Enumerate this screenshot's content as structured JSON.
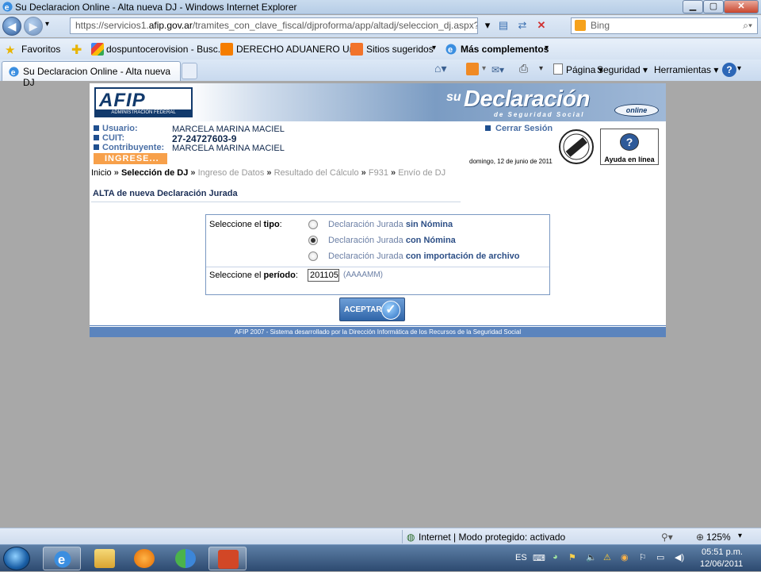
{
  "window": {
    "title": "Su Declaracion Online - Alta nueva DJ - Windows Internet Explorer",
    "min_icon": "minimize-icon",
    "max_icon": "maximize-icon",
    "close_icon": "close-icon"
  },
  "address": {
    "prefix": "https://servicios1.",
    "domain": "afip.gov.ar",
    "path": "/tramites_con_clave_fiscal/djproforma/app/altadj/seleccion_dj.aspx?",
    "search_placeholder": "Bing"
  },
  "favorites": {
    "label": "Favoritos",
    "items": [
      "dospuntocerovision - Busc...",
      "DERECHO ADUANERO Un...",
      "Sitios sugeridos",
      "Más complementos"
    ]
  },
  "tab": {
    "label": "Su Declaracion Online - Alta nueva DJ"
  },
  "tools": {
    "pagina": "Página",
    "seguridad": "Seguridad",
    "herramientas": "Herramientas"
  },
  "page": {
    "logo": {
      "big": "AFIP",
      "small": "ADMINISTRACION FEDERAL"
    },
    "brand": {
      "su": "su",
      "title": "Declaración",
      "subtitle": "de Seguridad Social",
      "online": "online"
    },
    "user": {
      "usuario_label": "Usuario:",
      "usuario": "MARCELA MARINA MACIEL",
      "cuit_label": "CUIT:",
      "cuit": "27-24727603-9",
      "contribuyente_label": "Contribuyente:",
      "contribuyente": "MARCELA MARINA MACIEL",
      "ingrese": "INGRESE..."
    },
    "cerrar_sesion": "Cerrar Sesión",
    "date": "domingo, 12 de junio de 2011",
    "ayuda": "Ayuda en línea",
    "breadcrumb": {
      "sep": "»",
      "items": [
        "Inicio",
        "Selección de DJ",
        "Ingreso de Datos",
        "Resultado del Cálculo",
        "F931",
        "Envío de DJ"
      ]
    },
    "title": "ALTA de nueva Declaración Jurada",
    "form": {
      "tipo_label_pre": "Seleccione el ",
      "tipo_label_b": "tipo",
      "tipo_label_post": ":",
      "options": [
        {
          "pre": "Declaración Jurada ",
          "b": "sin Nómina",
          "selected": false
        },
        {
          "pre": "Declaración Jurada ",
          "b": "con Nómina",
          "selected": true
        },
        {
          "pre": "Declaración Jurada ",
          "b": "con importación de archivo",
          "selected": false
        }
      ],
      "periodo_label_pre": "Seleccione el ",
      "periodo_label_b": "período",
      "periodo_label_post": ":",
      "periodo_value": "201105",
      "periodo_format": "(AAAAMM)"
    },
    "button": "ACEPTAR",
    "footer": "AFIP 2007 - Sistema desarrollado por la Dirección Informática de los Recursos de la Seguridad Social"
  },
  "status": {
    "zone": "Internet | Modo protegido: activado",
    "zoom": "125%"
  },
  "taskbar": {
    "lang": "ES",
    "time": "05:51 p.m.",
    "date": "12/06/2011"
  }
}
